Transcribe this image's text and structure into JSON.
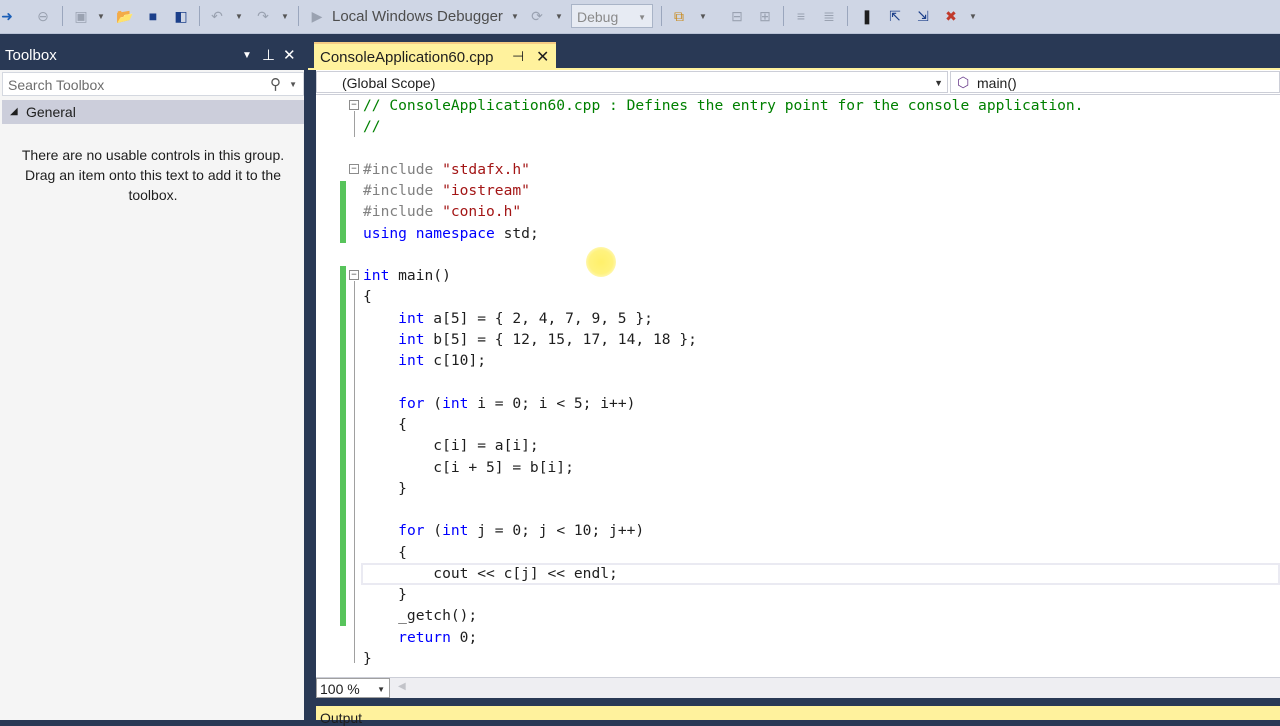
{
  "toolbar": {
    "debugger_label": "Local Windows Debugger",
    "config_value": "Debug"
  },
  "toolbox": {
    "title": "Toolbox",
    "search_placeholder": "Search Toolbox",
    "group_name": "General",
    "empty_message": "There are no usable controls in this group. Drag an item onto this text to add it to the toolbox."
  },
  "editor": {
    "tab_title": "ConsoleApplication60.cpp",
    "scope": "(Global Scope)",
    "member": "main()",
    "zoom": "100 %",
    "lines": [
      "// ConsoleApplication60.cpp : Defines the entry point for the console application.",
      "//",
      "",
      "#include \"stdafx.h\"",
      "#include \"iostream\"",
      "#include \"conio.h\"",
      "using namespace std;",
      "",
      "int main()",
      "{",
      "    int a[5] = { 2, 4, 7, 9, 5 };",
      "    int b[5] = { 12, 15, 17, 14, 18 };",
      "    int c[10];",
      "",
      "    for (int i = 0; i < 5; i++)",
      "    {",
      "        c[i] = a[i];",
      "        c[i + 5] = b[i];",
      "    }",
      "",
      "    for (int j = 0; j < 10; j++)",
      "    {",
      "        cout << c[j] << endl;",
      "    }",
      "    _getch();",
      "    return 0;",
      "}"
    ]
  },
  "output": {
    "title": "Output"
  },
  "colors": {
    "keyword": "#0000ff",
    "string": "#a31515",
    "comment": "#008000",
    "active_tab": "#fff29d",
    "change_bar": "#57c45b"
  }
}
